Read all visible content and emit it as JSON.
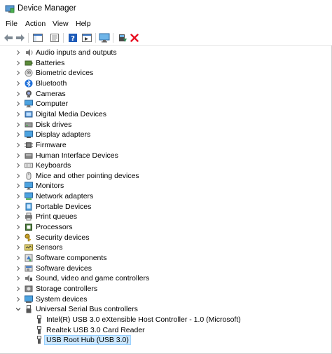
{
  "window": {
    "title": "Device Manager"
  },
  "menu": [
    "File",
    "Action",
    "View",
    "Help"
  ],
  "toolbar": {
    "buttons": [
      "back-arrow-icon",
      "forward-arrow-icon",
      "show-hide-console-tree-icon",
      "properties-icon",
      "help-icon",
      "view-icon",
      "monitor-icon",
      "update-driver-icon",
      "uninstall-icon"
    ]
  },
  "tree": {
    "categories": [
      {
        "label": "Audio inputs and outputs",
        "icon": "speaker-icon",
        "expanded": false
      },
      {
        "label": "Batteries",
        "icon": "battery-icon",
        "expanded": false
      },
      {
        "label": "Biometric devices",
        "icon": "fingerprint-icon",
        "expanded": false
      },
      {
        "label": "Bluetooth",
        "icon": "bluetooth-icon",
        "expanded": false
      },
      {
        "label": "Cameras",
        "icon": "camera-icon",
        "expanded": false
      },
      {
        "label": "Computer",
        "icon": "computer-icon",
        "expanded": false
      },
      {
        "label": "Digital Media Devices",
        "icon": "media-device-icon",
        "expanded": false
      },
      {
        "label": "Disk drives",
        "icon": "disk-drive-icon",
        "expanded": false
      },
      {
        "label": "Display adapters",
        "icon": "display-adapter-icon",
        "expanded": false
      },
      {
        "label": "Firmware",
        "icon": "firmware-icon",
        "expanded": false
      },
      {
        "label": "Human Interface Devices",
        "icon": "hid-icon",
        "expanded": false
      },
      {
        "label": "Keyboards",
        "icon": "keyboard-icon",
        "expanded": false
      },
      {
        "label": "Mice and other pointing devices",
        "icon": "mouse-icon",
        "expanded": false
      },
      {
        "label": "Monitors",
        "icon": "monitor-icon",
        "expanded": false
      },
      {
        "label": "Network adapters",
        "icon": "network-adapter-icon",
        "expanded": false
      },
      {
        "label": "Portable Devices",
        "icon": "portable-device-icon",
        "expanded": false
      },
      {
        "label": "Print queues",
        "icon": "printer-icon",
        "expanded": false
      },
      {
        "label": "Processors",
        "icon": "processor-icon",
        "expanded": false
      },
      {
        "label": "Security devices",
        "icon": "security-key-icon",
        "expanded": false
      },
      {
        "label": "Sensors",
        "icon": "sensor-icon",
        "expanded": false
      },
      {
        "label": "Software components",
        "icon": "software-component-icon",
        "expanded": false
      },
      {
        "label": "Software devices",
        "icon": "software-device-icon",
        "expanded": false
      },
      {
        "label": "Sound, video and game controllers",
        "icon": "sound-controller-icon",
        "expanded": false
      },
      {
        "label": "Storage controllers",
        "icon": "storage-controller-icon",
        "expanded": false
      },
      {
        "label": "System devices",
        "icon": "system-device-icon",
        "expanded": false
      },
      {
        "label": "Universal Serial Bus controllers",
        "icon": "usb-controller-icon",
        "expanded": true
      }
    ],
    "usb_children": [
      {
        "label": "Intel(R) USB 3.0 eXtensible Host Controller - 1.0 (Microsoft)",
        "icon": "usb-plug-icon",
        "selected": false
      },
      {
        "label": "Realtek USB 3.0 Card Reader",
        "icon": "usb-plug-icon",
        "selected": false
      },
      {
        "label": "USB Root Hub (USB 3.0)",
        "icon": "usb-plug-icon",
        "selected": true
      }
    ]
  },
  "colors": {
    "selection_bg": "#cce8ff",
    "selection_border": "#99d1ff",
    "uninstall_red": "#e81123",
    "update_green": "#2e8b57",
    "help_blue": "#1e5bb8"
  }
}
